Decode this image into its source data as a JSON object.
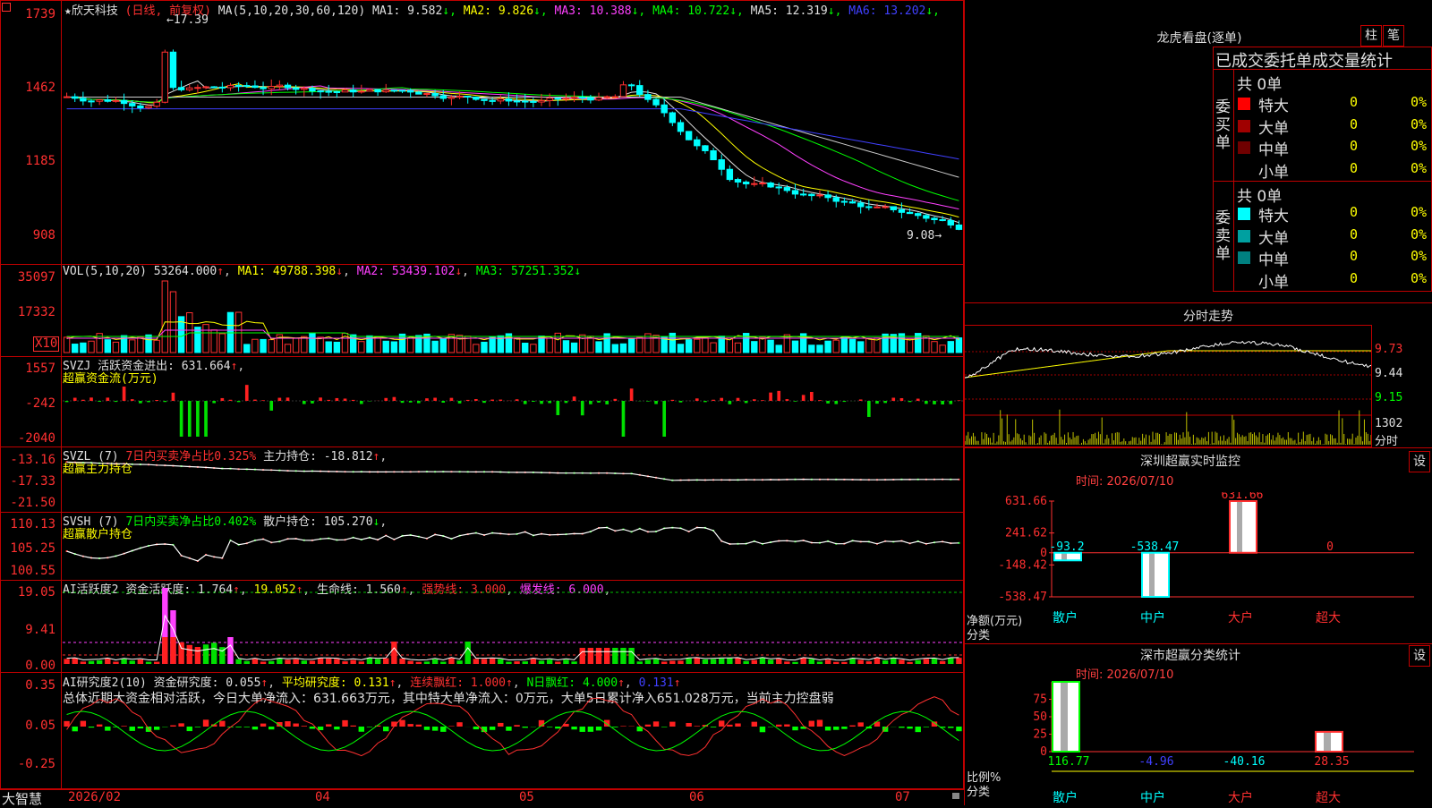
{
  "stock": {
    "name": "★欣天科技",
    "period": "(日线, 前复权)",
    "ma_label": "MA(5,10,20,30,60,120)",
    "ma_values": [
      {
        "label": "MA1: 9.582",
        "color": "#e0e0e0"
      },
      {
        "label": "MA2: 9.826",
        "color": "#ffff00"
      },
      {
        "label": "MA3: 10.388",
        "color": "#ff40ff"
      },
      {
        "label": "MA4: 10.722",
        "color": "#00ff00"
      },
      {
        "label": "MA5: 12.319",
        "color": "#e0e0e0"
      },
      {
        "label": "MA6: 13.202",
        "color": "#4040ff"
      }
    ],
    "high_mark": "17.39",
    "low_mark": "9.08",
    "price_ticks": [
      "1739",
      "1462",
      "1185",
      "908"
    ]
  },
  "vol": {
    "header": "VOL(5,10,20)",
    "value": "53264.000",
    "ma1": "MA1: 49788.398",
    "ma2": "MA2: 53439.102",
    "ma3": "MA3: 57251.352",
    "ticks": [
      "35097",
      "17332"
    ],
    "unit": "X10"
  },
  "svzj": {
    "header": "SVZJ",
    "label": "活跃资金进出: 631.664",
    "sub": "超赢资金流(万元)",
    "ticks": [
      "1557",
      "-242",
      "-2040"
    ]
  },
  "svzl": {
    "header": "SVZL (7)",
    "label1": "7日内买卖净占比0.325%",
    "label2": "主力持仓: -18.812",
    "sub": "超赢主力持仓",
    "ticks": [
      "-13.16",
      "-17.33",
      "-21.50"
    ]
  },
  "svsh": {
    "header": "SVSH (7)",
    "label1": "7日内买卖净占比0.402%",
    "label2": "散户持仓: 105.270",
    "sub": "超赢散户持仓",
    "ticks": [
      "110.13",
      "105.25",
      "100.55"
    ]
  },
  "ai1": {
    "header": "AI活跃度2",
    "l1": "资金活跃度: 1.764",
    "l2": "19.052",
    "l3": "生命线: 1.560",
    "l4": "强势线: 3.000",
    "l5": "爆发线: 6.000",
    "ticks": [
      "19.05",
      "9.41",
      "0.00"
    ]
  },
  "ai2": {
    "header": "AI研究度2(10)",
    "l1": "资金研究度: 0.055",
    "l2": "平均研究度: 0.131",
    "l3": "连续飘红: 1.000",
    "l4": "N日飘红: 4.000",
    "l5": "0.131",
    "summary": "总体近期大资金相对活跃，今日大单净流入：631.663万元，其中特大单净流入：0万元，大单5日累计净入651.028万元，当前主力控盘弱",
    "ticks": [
      "0.35",
      "0.05",
      "-0.25"
    ]
  },
  "xaxis": {
    "brand": "大智慧",
    "labels": [
      "2026/02",
      "04",
      "05",
      "06",
      "07"
    ]
  },
  "dragon": {
    "title": "龙虎看盘(逐单)",
    "btn1": "柱",
    "btn2": "笔",
    "subtitle": "已成交委托单成交量统计",
    "buy_label": "委买单",
    "sell_label": "委卖单",
    "buy_total": "共 0单",
    "sell_total": "共 0单",
    "buy_rows": [
      {
        "name": "特大",
        "val": "0",
        "pct": "0%",
        "color": "#ff0000"
      },
      {
        "name": "大单",
        "val": "0",
        "pct": "0%",
        "color": "#a00000"
      },
      {
        "name": "中单",
        "val": "0",
        "pct": "0%",
        "color": "#700000"
      },
      {
        "name": "小单",
        "val": "0",
        "pct": "0%",
        "color": ""
      }
    ],
    "sell_rows": [
      {
        "name": "特大",
        "val": "0",
        "pct": "0%",
        "color": "#00ffff"
      },
      {
        "name": "大单",
        "val": "0",
        "pct": "0%",
        "color": "#00a0a0"
      },
      {
        "name": "中单",
        "val": "0",
        "pct": "0%",
        "color": "#008080"
      },
      {
        "name": "小单",
        "val": "0",
        "pct": "0%",
        "color": ""
      }
    ]
  },
  "intraday": {
    "title": "分时走势",
    "ticks": [
      "9.73",
      "9.44",
      "9.15"
    ],
    "vol_tick": "1302",
    "vol_unit": "分时"
  },
  "sz_monitor": {
    "title": "深圳超赢实时监控",
    "btn": "设",
    "time": "时间: 2026/07/10",
    "yticks": [
      "631.66",
      "241.62",
      "0",
      "-148.42",
      "-538.47"
    ],
    "ylab": "净额(万元)",
    "xlab": "分类",
    "cats": [
      "散户",
      "中户",
      "大户",
      "超大"
    ],
    "values": [
      "-93.2",
      "-538.47",
      "631.66",
      "0"
    ]
  },
  "sz_class": {
    "title": "深市超赢分类统计",
    "btn": "设",
    "time": "时间: 2026/07/10",
    "yticks": [
      "75",
      "50",
      "25",
      "0"
    ],
    "ylab": "比例%",
    "xlab": "分类",
    "cats": [
      "散户",
      "中户",
      "大户",
      "超大"
    ],
    "values": [
      "116.77",
      "-4.96",
      "-40.16",
      "28.35"
    ]
  }
}
